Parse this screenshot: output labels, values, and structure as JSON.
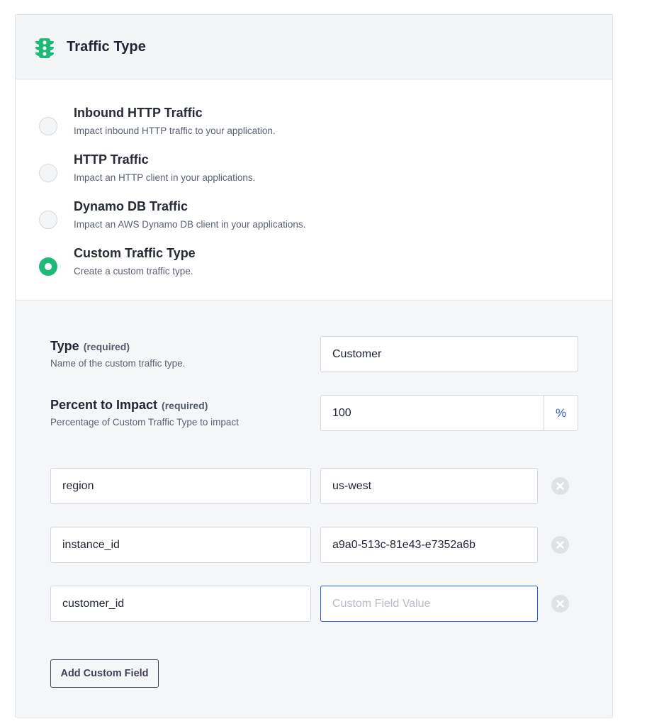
{
  "header": {
    "title": "Traffic Type",
    "icon": "traffic-light-icon",
    "icon_color": "#1fb977"
  },
  "traffic_options": [
    {
      "label": "Inbound HTTP Traffic",
      "description": "Impact inbound HTTP traffic to your application.",
      "selected": false
    },
    {
      "label": "HTTP Traffic",
      "description": "Impact an HTTP client in your applications.",
      "selected": false
    },
    {
      "label": "Dynamo DB Traffic",
      "description": "Impact an AWS Dynamo DB client in your applications.",
      "selected": false
    },
    {
      "label": "Custom Traffic Type",
      "description": "Create a custom traffic type.",
      "selected": true
    }
  ],
  "form": {
    "type": {
      "label": "Type",
      "required": "(required)",
      "help": "Name of the custom traffic type.",
      "value": "Customer"
    },
    "percent": {
      "label": "Percent to Impact",
      "required": "(required)",
      "help": "Percentage of Custom Traffic Type to impact",
      "value": "100",
      "unit": "%"
    },
    "custom_fields": [
      {
        "key": "region",
        "value": "us-west",
        "placeholder": "Custom Field Value"
      },
      {
        "key": "instance_id",
        "value": "a9a0-513c-81e43-e7352a6b",
        "placeholder": "Custom Field Value"
      },
      {
        "key": "customer_id",
        "value": "",
        "placeholder": "Custom Field Value"
      }
    ],
    "add_button_label": "Add Custom Field"
  },
  "colors": {
    "accent_green": "#1fb977",
    "focus_blue": "#2f5bd3"
  }
}
